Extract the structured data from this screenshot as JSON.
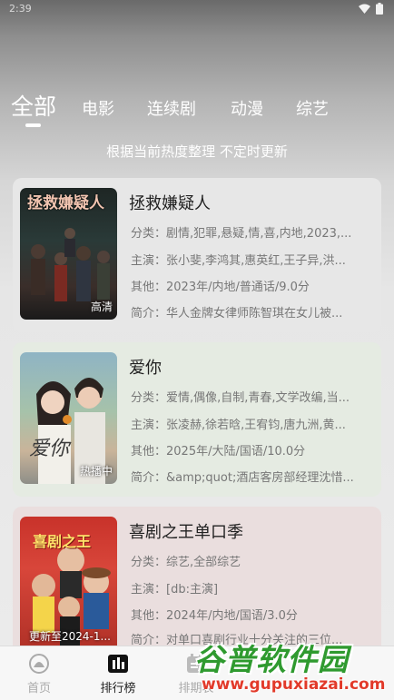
{
  "status_bar": {
    "time": "2:39"
  },
  "tabs": [
    {
      "label": "全部",
      "active": true
    },
    {
      "label": "电影"
    },
    {
      "label": "连续剧"
    },
    {
      "label": "动漫"
    },
    {
      "label": "综艺"
    }
  ],
  "subtitle": "根据当前热度整理 不定时更新",
  "cards": [
    {
      "title": "拯救嫌疑人",
      "poster_text": "拯救嫌疑人",
      "badge": "高清",
      "category": "分类：剧情,犯罪,悬疑,情,喜,内地,2023,...",
      "cast": "主演：张小斐,李鸿其,惠英红,王子异,洪...",
      "other": "其他：2023年/内地/普通话/9.0分",
      "intro": "简介：华人金牌女律师陈智琪在女儿被...",
      "bg": "#e7e7e7"
    },
    {
      "title": "爱你",
      "poster_text": "爱你",
      "badge": "热播中",
      "category": "分类：爱情,偶像,自制,青春,文学改编,当...",
      "cast": "主演：张凌赫,徐若晗,王宥钧,唐九洲,黄...",
      "other": "其他：2025年/大陆/国语/10.0分",
      "intro": "简介：&amp;quot;酒店客房部经理沈惜...",
      "bg": "#e5ebe2"
    },
    {
      "title": "喜剧之王单口季",
      "poster_text": "喜剧之王",
      "badge": "更新至2024-1...",
      "category": "分类：综艺,全部综艺",
      "cast": "主演：[db:主演]",
      "other": "其他：2024年/内地/国语/3.0分",
      "intro": "简介：对单口喜剧行业十分关注的三位...",
      "bg": "#eadede"
    }
  ],
  "nav": [
    {
      "label": "首页",
      "icon": "home-icon"
    },
    {
      "label": "排行榜",
      "icon": "ranking-icon",
      "active": true
    },
    {
      "label": "排期表",
      "icon": "calendar-icon"
    }
  ],
  "watermark": {
    "logo": "谷普软件园",
    "url": "www.gupuxiazai.com"
  }
}
